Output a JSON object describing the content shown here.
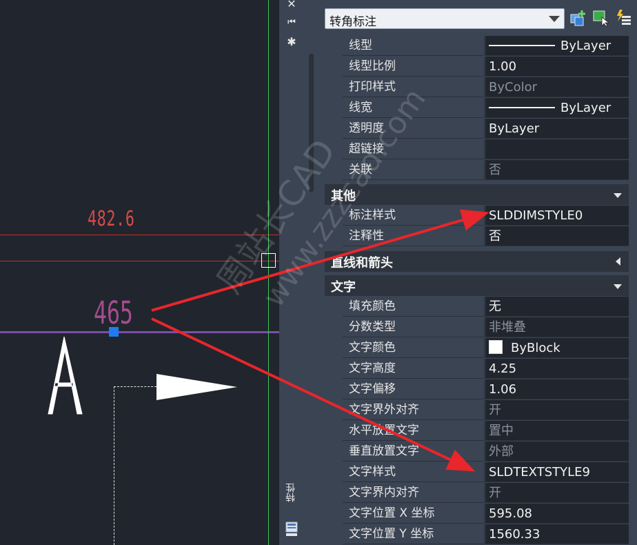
{
  "canvas": {
    "dim_text_top": "482.6",
    "dim_text_main": "465",
    "letter": "A"
  },
  "palette_strip": {
    "close_glyph": "✕",
    "collapse_glyph": "⏮",
    "settings_glyph": "✱",
    "title": "特性"
  },
  "panel": {
    "selector_value": "转角标注",
    "rows_general": [
      {
        "name": "线型",
        "value": "ByLayer",
        "sample": true
      },
      {
        "name": "线型比例",
        "value": "1.00"
      },
      {
        "name": "打印样式",
        "value": "ByColor",
        "dim": true
      },
      {
        "name": "线宽",
        "value": "ByLayer",
        "sample": true
      },
      {
        "name": "透明度",
        "value": "ByLayer"
      },
      {
        "name": "超链接",
        "value": ""
      },
      {
        "name": "关联",
        "value": "否",
        "dim": true
      }
    ],
    "section_other": "其他",
    "rows_other": [
      {
        "name": "标注样式",
        "value": "SLDDIMSTYLE0"
      },
      {
        "name": "注释性",
        "value": "否"
      }
    ],
    "section_lines": "直线和箭头",
    "section_text": "文字",
    "rows_text": [
      {
        "name": "填充颜色",
        "value": "无"
      },
      {
        "name": "分数类型",
        "value": "非堆叠",
        "dim": true
      },
      {
        "name": "文字颜色",
        "value": "ByBlock",
        "swatch": true
      },
      {
        "name": "文字高度",
        "value": "4.25"
      },
      {
        "name": "文字偏移",
        "value": "1.06"
      },
      {
        "name": "文字界外对齐",
        "value": "开",
        "dim": true
      },
      {
        "name": "水平放置文字",
        "value": "置中",
        "dim": true
      },
      {
        "name": "垂直放置文字",
        "value": "外部",
        "dim": true
      },
      {
        "name": "文字样式",
        "value": "SLDTEXTSTYLE9"
      },
      {
        "name": "文字界内对齐",
        "value": "开",
        "dim": true
      },
      {
        "name": "文字位置 X 坐标",
        "value": "595.08"
      },
      {
        "name": "文字位置 Y 坐标",
        "value": "1560.33"
      }
    ]
  },
  "watermark": {
    "line1": "周站长CAD",
    "line2": "www.zzzcad.com"
  },
  "colors": {
    "annotation_arrow": "#e8262b",
    "dim_line_red": "#c43030",
    "dim_line_purple": "#7b4fa8",
    "grip_blue": "#1e7cf0",
    "viewport_green": "#3ec95a"
  }
}
